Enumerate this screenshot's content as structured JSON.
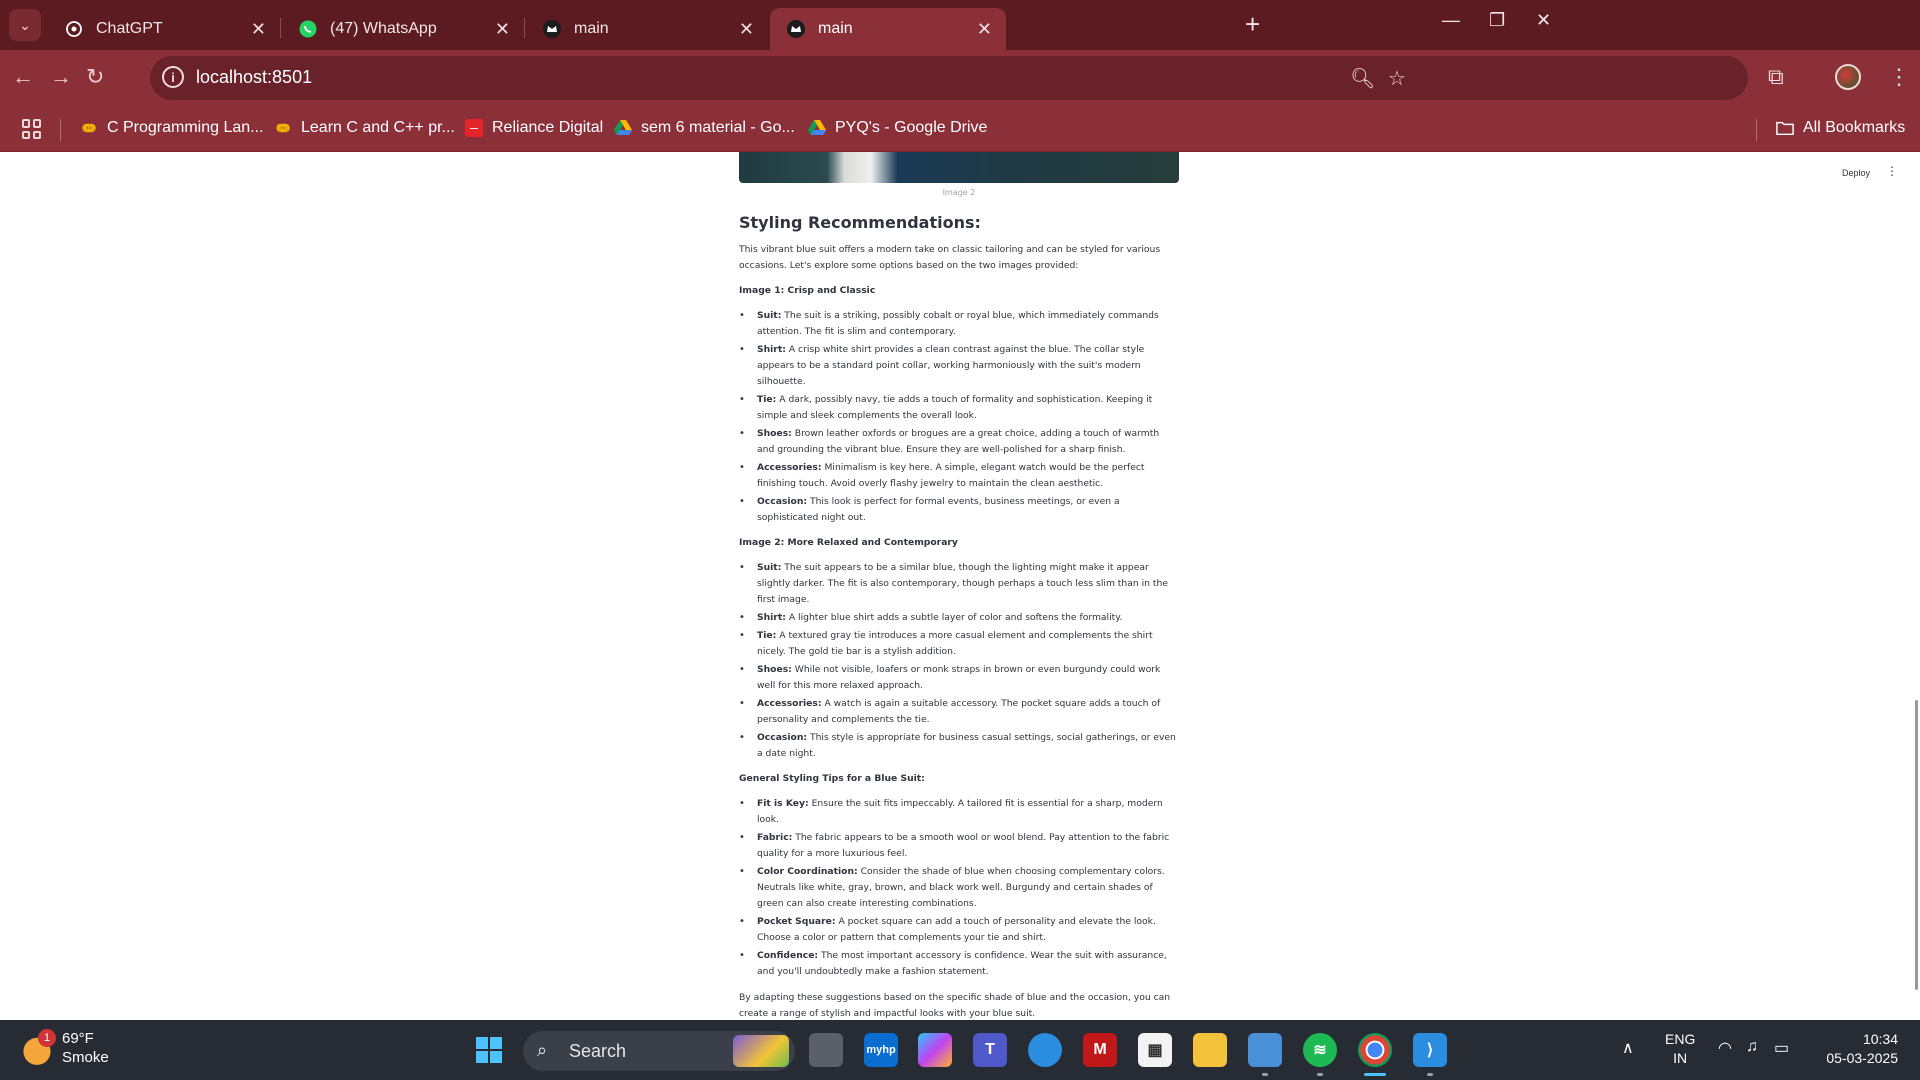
{
  "browser": {
    "tabs": [
      {
        "title": "ChatGPT",
        "icon": "chatgpt-icon"
      },
      {
        "title": "(47) WhatsApp",
        "icon": "whatsapp-icon"
      },
      {
        "title": "main",
        "icon": "streamlit-crown-icon"
      },
      {
        "title": "main",
        "icon": "streamlit-crown-icon",
        "active": true
      }
    ],
    "url": "localhost:8501",
    "bookmarks": [
      {
        "label": "C Programming Lan...",
        "icon": "dji-icon"
      },
      {
        "label": "Learn C and C++ pr...",
        "icon": "dji-icon"
      },
      {
        "label": "Reliance Digital",
        "icon": "reliance-icon"
      },
      {
        "label": "sem 6 material - Go...",
        "icon": "google-drive-icon"
      },
      {
        "label": "PYQ's - Google Drive",
        "icon": "google-drive-icon"
      }
    ],
    "all_bookmarks": "All Bookmarks",
    "accent": "#8b2f39"
  },
  "app": {
    "deploy": "Deploy",
    "image_caption": "Image 2",
    "heading": "Styling Recommendations:",
    "intro": "This vibrant blue suit offers a modern take on classic tailoring and can be styled for various occasions. Let's explore some options based on the two images provided:",
    "section1": {
      "title": "Image 1: Crisp and Classic",
      "items": [
        {
          "k": "Suit:",
          "v": " The suit is a striking, possibly cobalt or royal blue, which immediately commands attention. The fit is slim and contemporary."
        },
        {
          "k": "Shirt:",
          "v": " A crisp white shirt provides a clean contrast against the blue. The collar style appears to be a standard point collar, working harmoniously with the suit's modern silhouette."
        },
        {
          "k": "Tie:",
          "v": " A dark, possibly navy, tie adds a touch of formality and sophistication. Keeping it simple and sleek complements the overall look."
        },
        {
          "k": "Shoes:",
          "v": " Brown leather oxfords or brogues are a great choice, adding a touch of warmth and grounding the vibrant blue. Ensure they are well-polished for a sharp finish."
        },
        {
          "k": "Accessories:",
          "v": " Minimalism is key here. A simple, elegant watch would be the perfect finishing touch. Avoid overly flashy jewelry to maintain the clean aesthetic."
        },
        {
          "k": "Occasion:",
          "v": " This look is perfect for formal events, business meetings, or even a sophisticated night out."
        }
      ]
    },
    "section2": {
      "title": "Image 2: More Relaxed and Contemporary",
      "items": [
        {
          "k": "Suit:",
          "v": " The suit appears to be a similar blue, though the lighting might make it appear slightly darker. The fit is also contemporary, though perhaps a touch less slim than in the first image."
        },
        {
          "k": "Shirt:",
          "v": " A lighter blue shirt adds a subtle layer of color and softens the formality."
        },
        {
          "k": "Tie:",
          "v": " A textured gray tie introduces a more casual element and complements the shirt nicely. The gold tie bar is a stylish addition."
        },
        {
          "k": "Shoes:",
          "v": " While not visible, loafers or monk straps in brown or even burgundy could work well for this more relaxed approach."
        },
        {
          "k": "Accessories:",
          "v": " A watch is again a suitable accessory. The pocket square adds a touch of personality and complements the tie."
        },
        {
          "k": "Occasion:",
          "v": " This style is appropriate for business casual settings, social gatherings, or even a date night."
        }
      ]
    },
    "section3": {
      "title": "General Styling Tips for a Blue Suit:",
      "items": [
        {
          "k": "Fit is Key:",
          "v": " Ensure the suit fits impeccably. A tailored fit is essential for a sharp, modern look."
        },
        {
          "k": "Fabric:",
          "v": " The fabric appears to be a smooth wool or wool blend. Pay attention to the fabric quality for a more luxurious feel."
        },
        {
          "k": "Color Coordination:",
          "v": " Consider the shade of blue when choosing complementary colors. Neutrals like white, gray, brown, and black work well. Burgundy and certain shades of green can also create interesting combinations."
        },
        {
          "k": "Pocket Square:",
          "v": " A pocket square can add a touch of personality and elevate the look. Choose a color or pattern that complements your tie and shirt."
        },
        {
          "k": "Confidence:",
          "v": " The most important accessory is confidence. Wear the suit with assurance, and you'll undoubtedly make a fashion statement."
        }
      ]
    },
    "outro": "By adapting these suggestions based on the specific shade of blue and the occasion, you can create a range of stylish and impactful looks with your blue suit."
  },
  "taskbar": {
    "weather_temp": "69°F",
    "weather_desc": "Smoke",
    "weather_badge": "1",
    "search_placeholder": "Search",
    "lang1": "ENG",
    "lang2": "IN",
    "time": "10:34",
    "date": "05-03-2025"
  }
}
